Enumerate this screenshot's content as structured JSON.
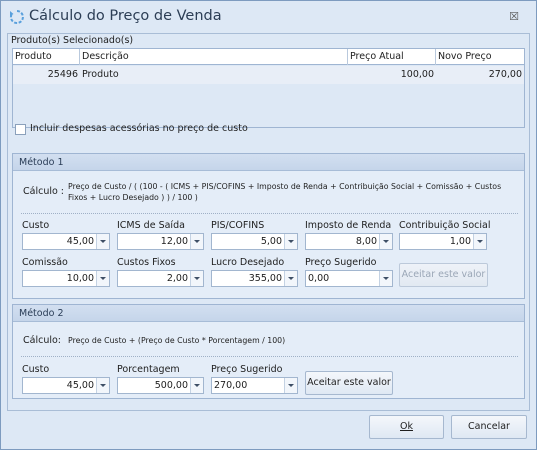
{
  "window": {
    "title": "Cálculo do Preço de Venda",
    "close_symbol": "☒"
  },
  "products": {
    "section_label": "Produto(s) Selecionado(s)",
    "columns": [
      "Produto",
      "Descrição",
      "Preço Atual",
      "Novo Preço"
    ],
    "rows": [
      {
        "produto": "25496",
        "descricao": "Produto",
        "preco_atual": "100,00",
        "novo_preco": "270,00"
      }
    ]
  },
  "include_costs": {
    "label": "Incluir despesas acessórias no preço de custo",
    "checked": false
  },
  "metodo1": {
    "title": "Método 1",
    "calc_label": "Cálculo :",
    "formula_line1": "Preço de Custo / ( (100 - ( ICMS + PIS/COFINS + Imposto de Renda + Contribuição Social + Comissão + Custos",
    "formula_line2": "Fixos + Lucro Desejado ) ) / 100 )",
    "fields": [
      {
        "label": "Custo",
        "value": "45,00"
      },
      {
        "label": "ICMS de Saída",
        "value": "12,00"
      },
      {
        "label": "PIS/COFINS",
        "value": "5,00"
      },
      {
        "label": "Imposto de Renda",
        "value": "8,00"
      },
      {
        "label": "Contribuição Social",
        "value": "1,00"
      },
      {
        "label": "Comissão",
        "value": "10,00"
      },
      {
        "label": "Custos Fixos",
        "value": "2,00"
      },
      {
        "label": "Lucro Desejado",
        "value": "355,00"
      },
      {
        "label": "Preço Sugerido",
        "value": "0,00"
      }
    ],
    "accept_label": "Aceitar este valor"
  },
  "metodo2": {
    "title": "Método 2",
    "calc_label": "Cálculo:",
    "formula": "Preço de Custo + (Preço de Custo * Porcentagem / 100)",
    "fields": [
      {
        "label": "Custo",
        "value": "45,00"
      },
      {
        "label": "Porcentagem",
        "value": "500,00"
      },
      {
        "label": "Preço Sugerido",
        "value": "270,00"
      }
    ],
    "accept_label": "Aceitar este valor"
  },
  "footer": {
    "ok_label": "Ok",
    "cancel_label": "Cancelar"
  }
}
